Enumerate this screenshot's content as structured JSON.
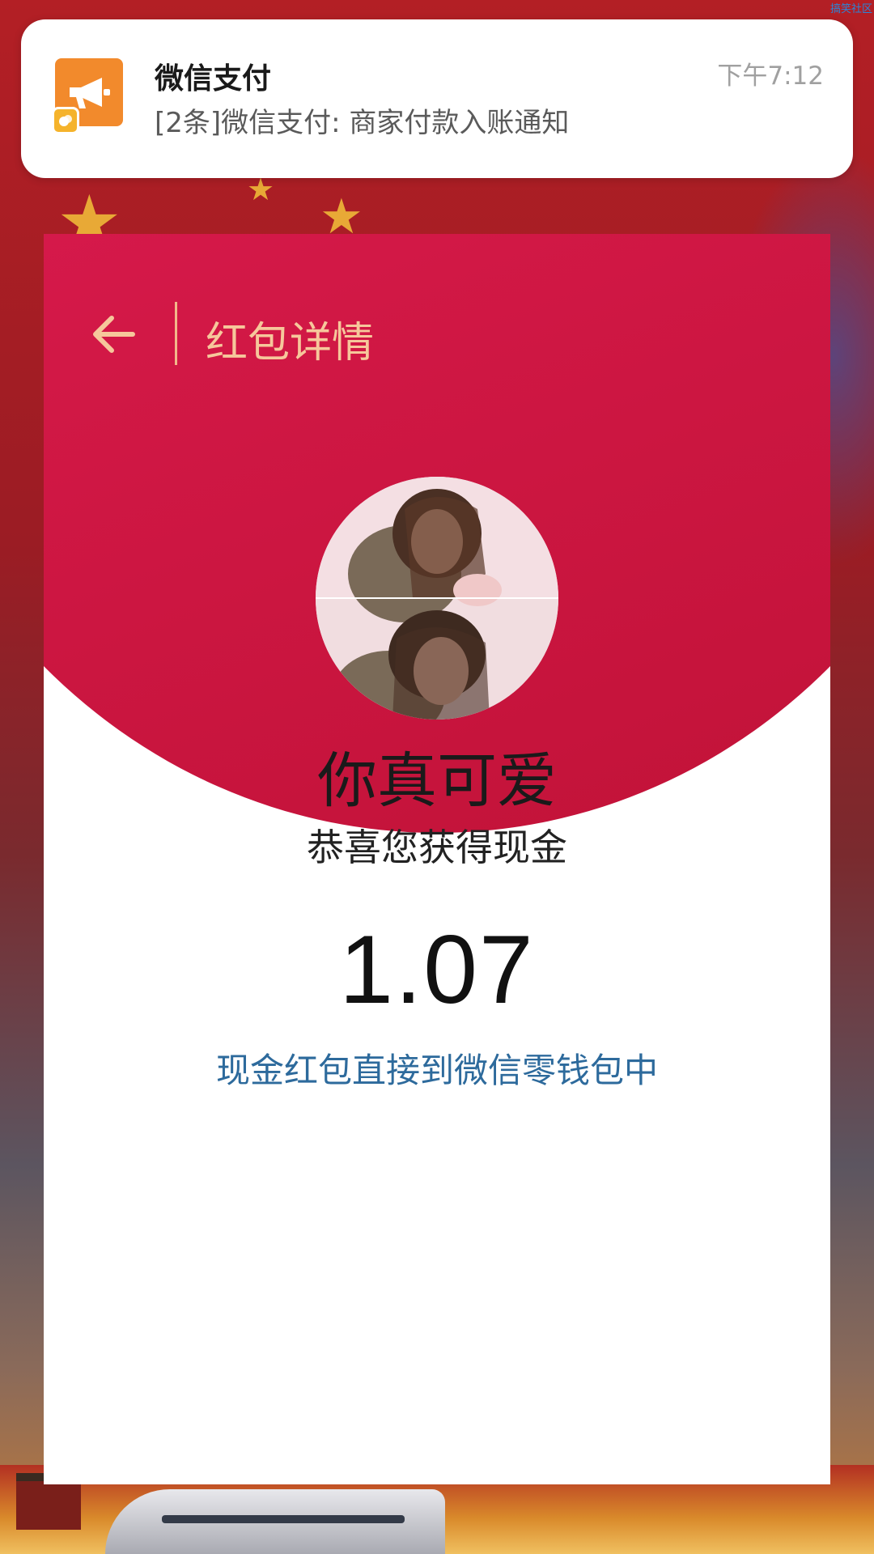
{
  "watermark": "搞笑社区",
  "notification": {
    "app_icon": "megaphone-icon",
    "badge_icon": "wechat-pay-badge-icon",
    "title": "微信支付",
    "time": "下午7:12",
    "body": "[2条]微信支付: 商家付款入账通知"
  },
  "red_packet": {
    "back_icon": "back-arrow-icon",
    "header_title": "红包详情",
    "sender_name": "你真可爱",
    "greeting": "恭喜您获得现金",
    "amount": "1.07",
    "wallet_link": "现金红包直接到微信零钱包中"
  },
  "colors": {
    "header_red": "#d21846",
    "header_text": "#f6c79b",
    "link_blue": "#2d6a9c",
    "notif_icon_orange": "#f28a2c"
  }
}
